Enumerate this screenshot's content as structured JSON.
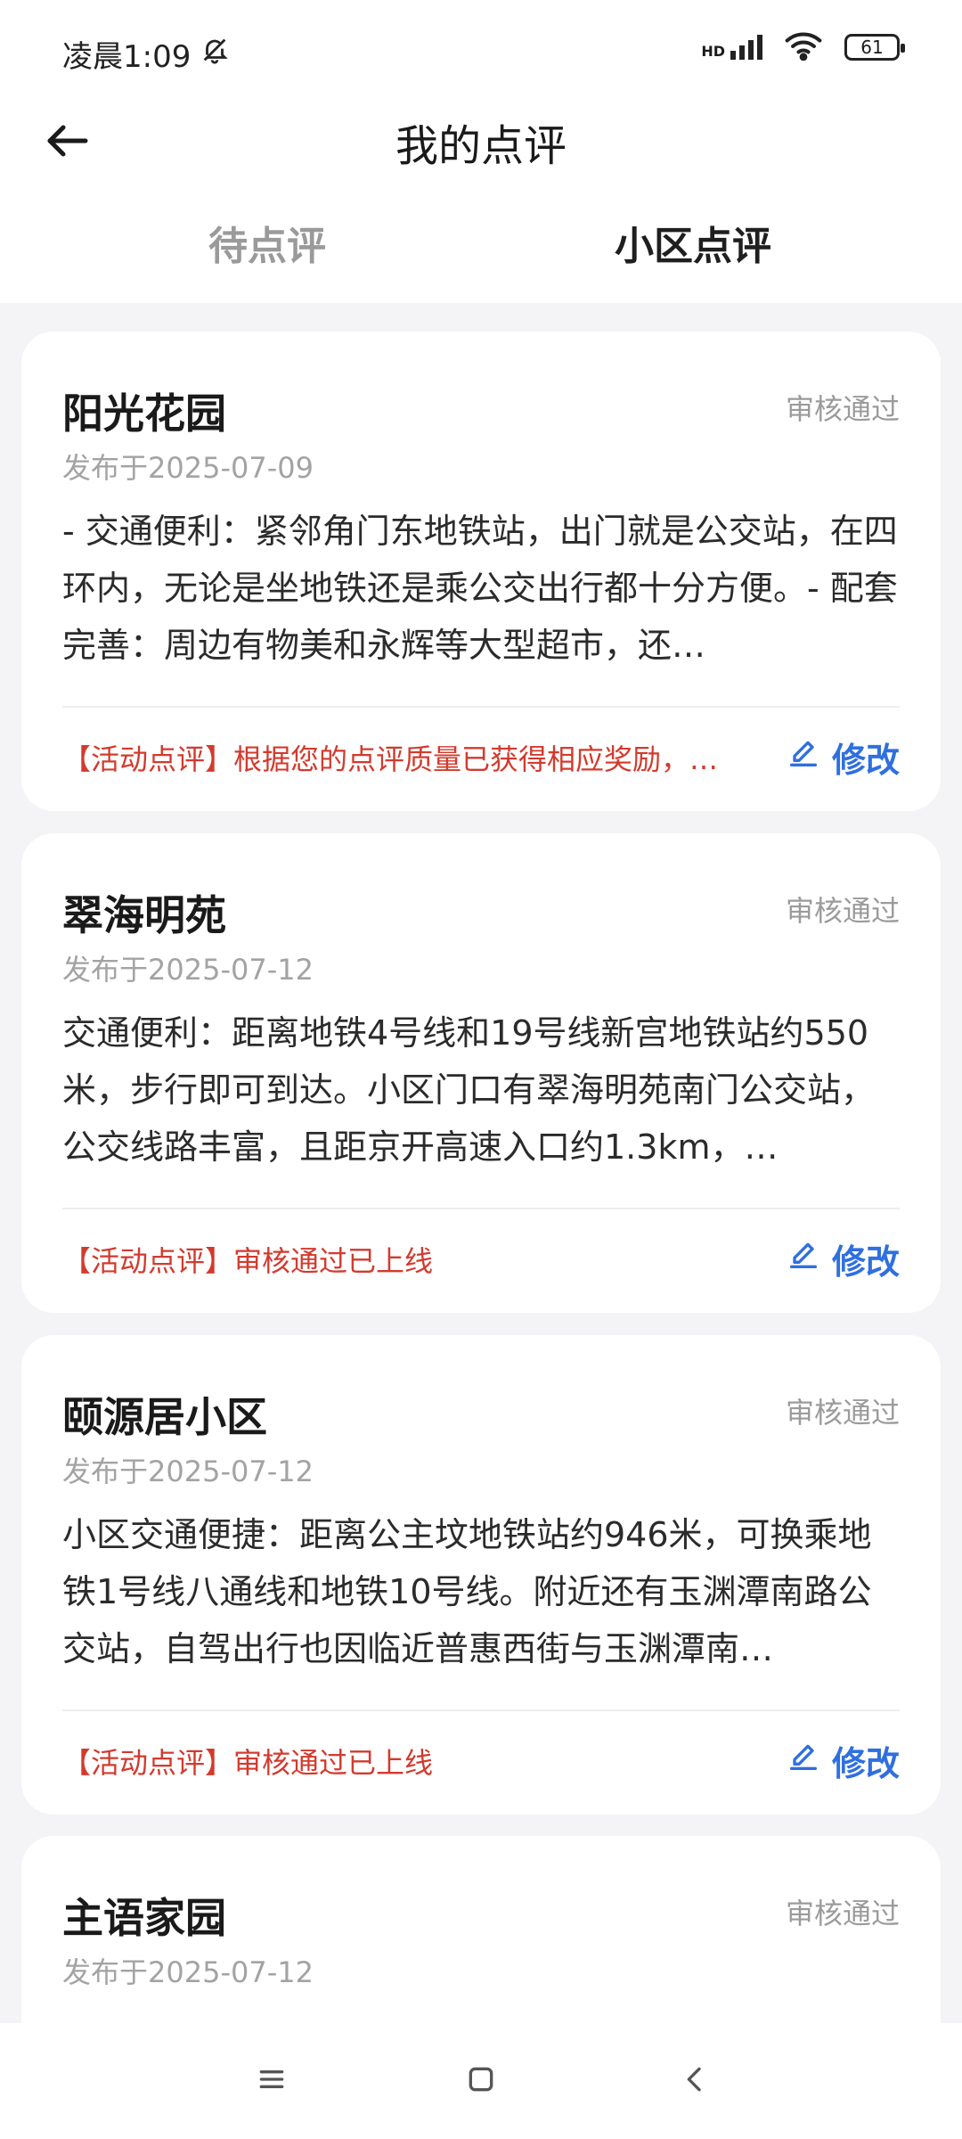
{
  "status_bar": {
    "time": "凌晨1:09",
    "network": "HD",
    "battery": "61",
    "icons": [
      "mute-bell-icon",
      "signal-icon",
      "wifi-icon",
      "battery-icon"
    ]
  },
  "header": {
    "title": "我的点评",
    "back_icon": "arrow-left-icon"
  },
  "tabs": [
    {
      "label": "待点评",
      "active": false
    },
    {
      "label": "小区点评",
      "active": true
    }
  ],
  "cards": [
    {
      "name": "阳光花园",
      "status": "审核通过",
      "date": "发布于2025-07-09",
      "content": "- 交通便利：紧邻角门东地铁站，出门就是公交站，在四环内，无论是坐地铁还是乘公交出行都十分方便。- 配套完善：周边有物美和永辉等大型超市，还…",
      "promo": "【活动点评】根据您的点评质量已获得相应奖励，…",
      "edit_label": "修改"
    },
    {
      "name": "翠海明苑",
      "status": "审核通过",
      "date": "发布于2025-07-12",
      "content": "交通便利：距离地铁4号线和19号线新宫地铁站约550米，步行即可到达。小区门口有翠海明苑南门公交站，公交线路丰富，且距京开高速入口约1.3km，…",
      "promo": "【活动点评】审核通过已上线",
      "edit_label": "修改"
    },
    {
      "name": "颐源居小区",
      "status": "审核通过",
      "date": "发布于2025-07-12",
      "content": "小区交通便捷：距离公主坟地铁站约946米，可换乘地铁1号线八通线和地铁10号线。附近还有玉渊潭南路公交站，自驾出行也因临近普惠西街与玉渊潭南…",
      "promo": "【活动点评】审核通过已上线",
      "edit_label": "修改"
    },
    {
      "name": "主语家园",
      "status": "审核通过",
      "date": "发布于2025-07-12",
      "content": "",
      "promo": "",
      "edit_label": ""
    }
  ],
  "colors": {
    "accent_blue": "#2f6fe0",
    "promo_red": "#d33a2d",
    "page_bg": "#f4f4f6"
  },
  "navbar": {
    "icons": [
      "menu-icon",
      "home-square-icon",
      "back-chevron-icon"
    ]
  }
}
